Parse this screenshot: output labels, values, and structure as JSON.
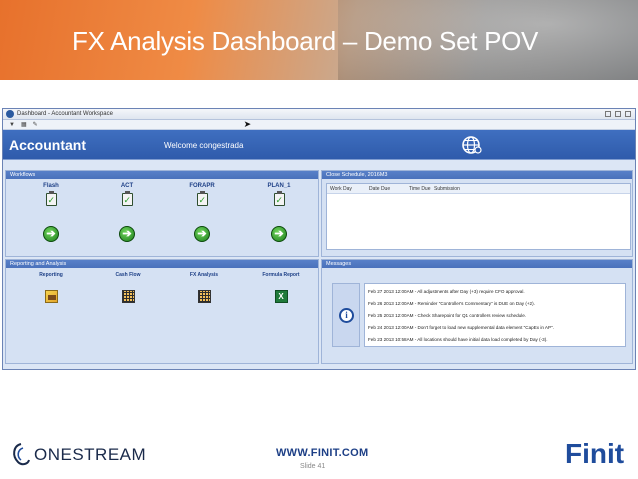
{
  "slide": {
    "title": "FX Analysis Dashboard – Demo Set POV",
    "website": "WWW.FINIT.COM",
    "slide_number": "Slide 41"
  },
  "window": {
    "title": "Dashboard - Accountant Workspace",
    "controls": [
      "minimize",
      "maximize",
      "close"
    ]
  },
  "banner": {
    "role": "Accountant",
    "welcome": "Welcome congestrada"
  },
  "workflows": {
    "heading": "Workflows",
    "items": [
      "Flash",
      "ACT",
      "FORAPR",
      "PLAN_1"
    ]
  },
  "close_schedule": {
    "heading": "Close Schedule, 2016M3",
    "columns": [
      "Work Day",
      "Date Due",
      "Time Due",
      "Submission"
    ]
  },
  "reporting": {
    "heading": "Reporting and Analysis",
    "items": [
      {
        "label": "Reporting",
        "icon": "report-icon"
      },
      {
        "label": "Cash Flow",
        "icon": "grid-icon"
      },
      {
        "label": "FX Analysis",
        "icon": "grid-icon"
      },
      {
        "label": "Formula Report",
        "icon": "excel-icon"
      }
    ]
  },
  "messages": {
    "heading": "Messages",
    "items": [
      "Feb 27 2013 12:00AM - All adjustments after Day (+3) require CFO approval.",
      "Feb 26 2013 12:00AM - Reminder \"Controller's Commentary\" is DUE on Day (+2).",
      "Feb 25 2013 12:00AM - Check Sharepoint for Q1 controllers review schedule.",
      "Feb 24 2013 12:00AM - Don't forget to load new supplemental data element \"CapEx in AP\".",
      "Feb 23 2013 10:58AM - All locations should have initial data load completed by Day (-3)."
    ]
  },
  "brands": {
    "left_logo": "ONESTREAM",
    "right_logo": "Finit"
  },
  "colors": {
    "header_orange": "#e7712c",
    "banner_blue": "#2f5bab",
    "section_blue": "#4a71bb",
    "finit_blue": "#1f4c9c"
  }
}
